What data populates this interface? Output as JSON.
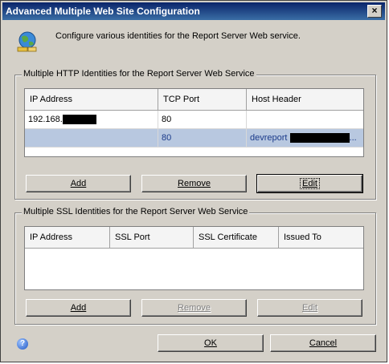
{
  "window": {
    "title": "Advanced Multiple Web Site Configuration",
    "close": "×"
  },
  "header": {
    "text": "Configure various identities for the Report Server Web service."
  },
  "http_group": {
    "label": "Multiple HTTP Identities for the Report Server Web Service",
    "columns": [
      "IP Address",
      "TCP Port",
      "Host Header"
    ],
    "rows": [
      {
        "ip": "192.168.",
        "port": "80",
        "host": ""
      },
      {
        "ip": "",
        "port": "80",
        "host": "devreport",
        "host_suffix": "..."
      }
    ],
    "buttons": {
      "add": "Add",
      "remove": "Remove",
      "edit": "Edit"
    }
  },
  "ssl_group": {
    "label": "Multiple SSL Identities for the Report Server Web Service",
    "columns": [
      "IP Address",
      "SSL Port",
      "SSL Certificate",
      "Issued To"
    ],
    "buttons": {
      "add": "Add",
      "remove": "Remove",
      "edit": "Edit"
    }
  },
  "footer": {
    "ok": "OK",
    "cancel": "Cancel",
    "help": "?"
  }
}
